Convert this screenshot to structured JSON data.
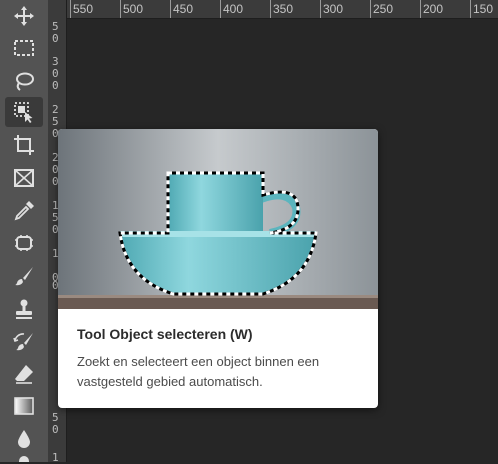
{
  "toolbar": {
    "tools": [
      {
        "name": "move-tool",
        "icon": "move-icon"
      },
      {
        "name": "rectangular-marquee-tool",
        "icon": "marquee-icon"
      },
      {
        "name": "lasso-tool",
        "icon": "lasso-icon"
      },
      {
        "name": "object-selection-tool",
        "icon": "object-selection-icon",
        "active": true
      },
      {
        "name": "crop-tool",
        "icon": "crop-icon"
      },
      {
        "name": "frame-tool",
        "icon": "frame-icon"
      },
      {
        "name": "eyedropper-tool",
        "icon": "eyedropper-icon"
      },
      {
        "name": "spot-healing-tool",
        "icon": "healing-patch-icon"
      },
      {
        "name": "brush-tool",
        "icon": "brush-icon"
      },
      {
        "name": "clone-stamp-tool",
        "icon": "stamp-icon"
      },
      {
        "name": "history-brush-tool",
        "icon": "history-brush-icon"
      },
      {
        "name": "eraser-tool",
        "icon": "eraser-icon"
      },
      {
        "name": "gradient-tool",
        "icon": "gradient-icon"
      },
      {
        "name": "blur-tool",
        "icon": "drop-icon"
      }
    ]
  },
  "ruler": {
    "horizontal_labels": [
      "550",
      "500",
      "450",
      "400",
      "350",
      "300",
      "250",
      "200",
      "150"
    ],
    "vertical_digits": [
      "5",
      "0",
      "3",
      "0",
      "0",
      "2",
      "5",
      "0",
      "2",
      "0",
      "0",
      "1",
      "5",
      "0",
      "1",
      "0",
      "0",
      "5",
      "0",
      "1"
    ]
  },
  "tooltip": {
    "title": "Tool Object selecteren (W)",
    "description": "Zoekt en selecteert een object binnen een vastgesteld gebied automatisch.",
    "image_alt": "cup-and-bowl"
  },
  "colors": {
    "toolbar_bg": "#535353",
    "canvas_bg": "#262626",
    "ruler_bg": "#3b3b3b",
    "cup_color": "#74c9d1"
  }
}
